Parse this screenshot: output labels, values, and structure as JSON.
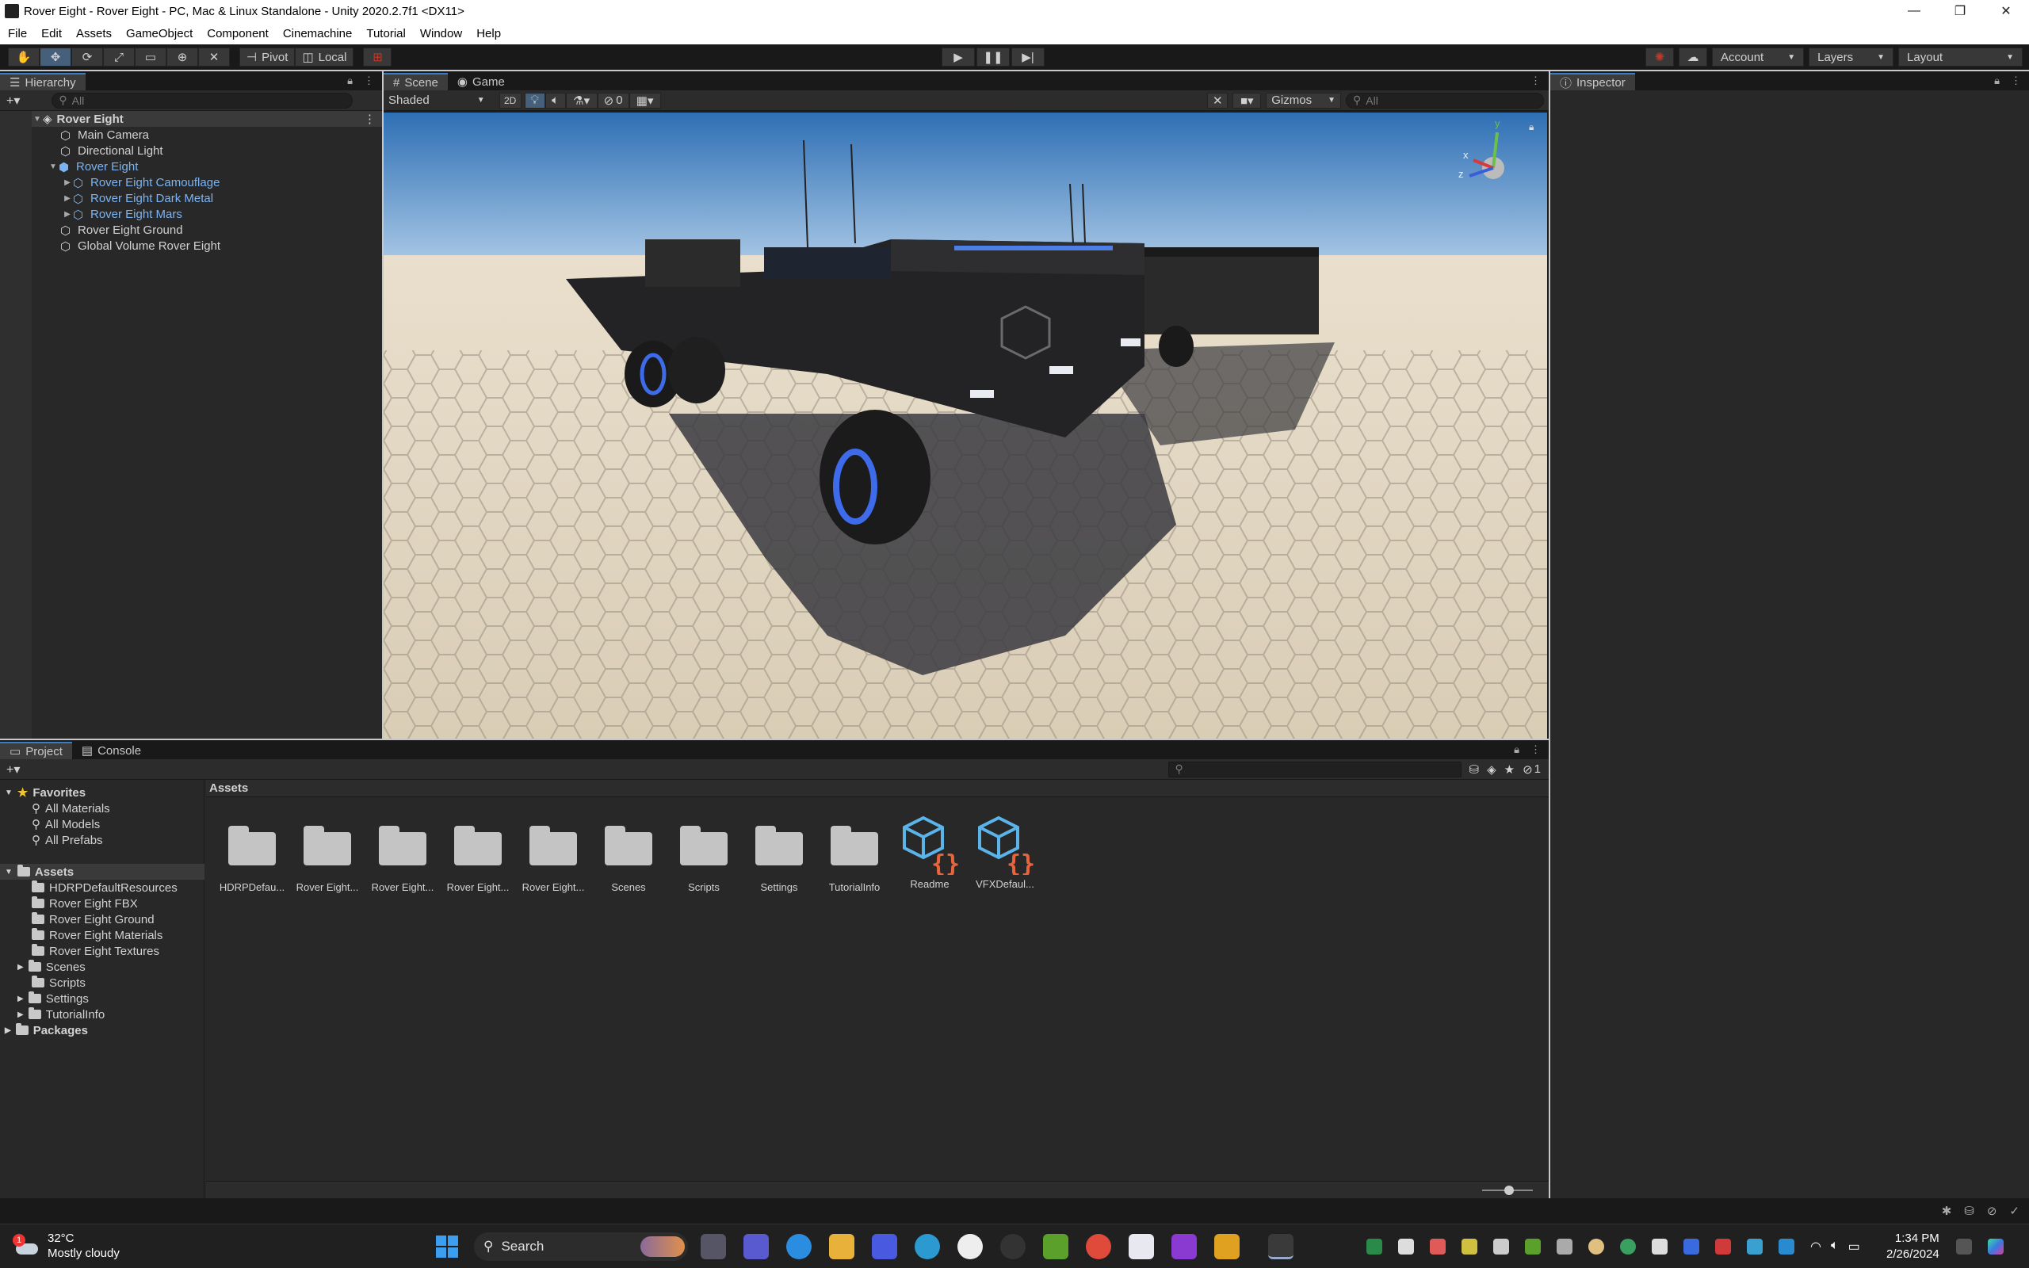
{
  "window": {
    "title": "Rover Eight - Rover Eight - PC, Mac & Linux Standalone - Unity 2020.2.7f1 <DX11>",
    "minimize": "—",
    "maximize": "❐",
    "close": "✕"
  },
  "menu": [
    "File",
    "Edit",
    "Assets",
    "GameObject",
    "Component",
    "Cinemachine",
    "Tutorial",
    "Window",
    "Help"
  ],
  "toolbar": {
    "pivot": "Pivot",
    "local": "Local",
    "account": "Account",
    "layers": "Layers",
    "layout": "Layout"
  },
  "hierarchy": {
    "tab": "Hierarchy",
    "search_placeholder": "All",
    "scene": "Rover Eight",
    "items": [
      {
        "label": "Main Camera"
      },
      {
        "label": "Directional Light"
      },
      {
        "label": "Rover Eight"
      },
      {
        "label": "Rover Eight Camouflage"
      },
      {
        "label": "Rover Eight Dark Metal"
      },
      {
        "label": "Rover Eight Mars"
      },
      {
        "label": "Rover Eight Ground"
      },
      {
        "label": "Global Volume Rover Eight"
      }
    ]
  },
  "scene_view": {
    "tab_scene": "Scene",
    "tab_game": "Game",
    "shading": "Shaded",
    "mode_2d": "2D",
    "hidden_count": "0",
    "gizmos": "Gizmos",
    "search_placeholder": "All",
    "axis_y": "y",
    "axis_x": "x",
    "axis_z": "z"
  },
  "inspector": {
    "tab": "Inspector"
  },
  "project": {
    "tab_project": "Project",
    "tab_console": "Console",
    "favorites": "Favorites",
    "favorite_items": [
      "All Materials",
      "All Models",
      "All Prefabs"
    ],
    "assets_root": "Assets",
    "asset_folders": [
      "HDRPDefaultResources",
      "Rover Eight FBX",
      "Rover Eight Ground",
      "Rover Eight Materials",
      "Rover Eight Textures",
      "Scenes",
      "Scripts",
      "Settings",
      "TutorialInfo"
    ],
    "packages": "Packages",
    "breadcrumb": "Assets",
    "hidden_packages_count": "1",
    "grid": [
      {
        "label": "HDRPDefau...",
        "kind": "folder"
      },
      {
        "label": "Rover Eight...",
        "kind": "folder"
      },
      {
        "label": "Rover Eight...",
        "kind": "folder"
      },
      {
        "label": "Rover Eight...",
        "kind": "folder"
      },
      {
        "label": "Rover Eight...",
        "kind": "folder"
      },
      {
        "label": "Scenes",
        "kind": "folder"
      },
      {
        "label": "Scripts",
        "kind": "folder"
      },
      {
        "label": "Settings",
        "kind": "folder"
      },
      {
        "label": "TutorialInfo",
        "kind": "folder"
      },
      {
        "label": "Readme",
        "kind": "script-asset"
      },
      {
        "label": "VFXDefaul...",
        "kind": "script-asset"
      }
    ]
  },
  "taskbar": {
    "weather_temp": "32°C",
    "weather_desc": "Mostly cloudy",
    "weather_badge": "1",
    "search": "Search",
    "time": "1:34 PM",
    "date": "2/26/2024"
  }
}
